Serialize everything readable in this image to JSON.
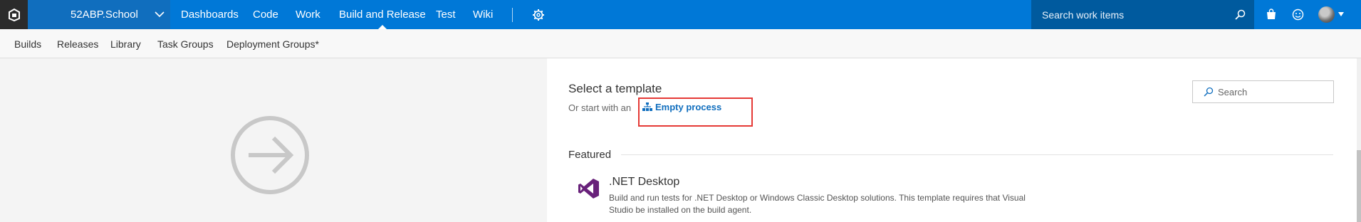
{
  "header": {
    "project_name": "52ABP.School",
    "nav": [
      {
        "label": "Dashboards"
      },
      {
        "label": "Code"
      },
      {
        "label": "Work"
      },
      {
        "label": "Build and Release"
      },
      {
        "label": "Test"
      },
      {
        "label": "Wiki"
      }
    ],
    "active_nav": "Build and Release",
    "search_placeholder": "Search work items"
  },
  "subnav": {
    "items": [
      {
        "label": "Builds"
      },
      {
        "label": "Releases"
      },
      {
        "label": "Library"
      },
      {
        "label": "Task Groups"
      },
      {
        "label": "Deployment Groups*"
      }
    ]
  },
  "main": {
    "title": "Select a template",
    "subtitle": "Or start with an",
    "empty_process_label": "Empty process",
    "search_placeholder": "Search",
    "featured_label": "Featured",
    "templates": [
      {
        "name": ".NET Desktop",
        "description": "Build and run tests for .NET Desktop or Windows Classic Desktop solutions. This template requires that Visual Studio be installed on the build agent.",
        "icon": "visual-studio-icon"
      }
    ]
  },
  "colors": {
    "topbar": "#0078d7",
    "project_bg": "#106ebe",
    "search_bg": "#005a9e",
    "link": "#106ebe",
    "highlight_box": "#e53935",
    "vs_purple": "#68217a"
  }
}
